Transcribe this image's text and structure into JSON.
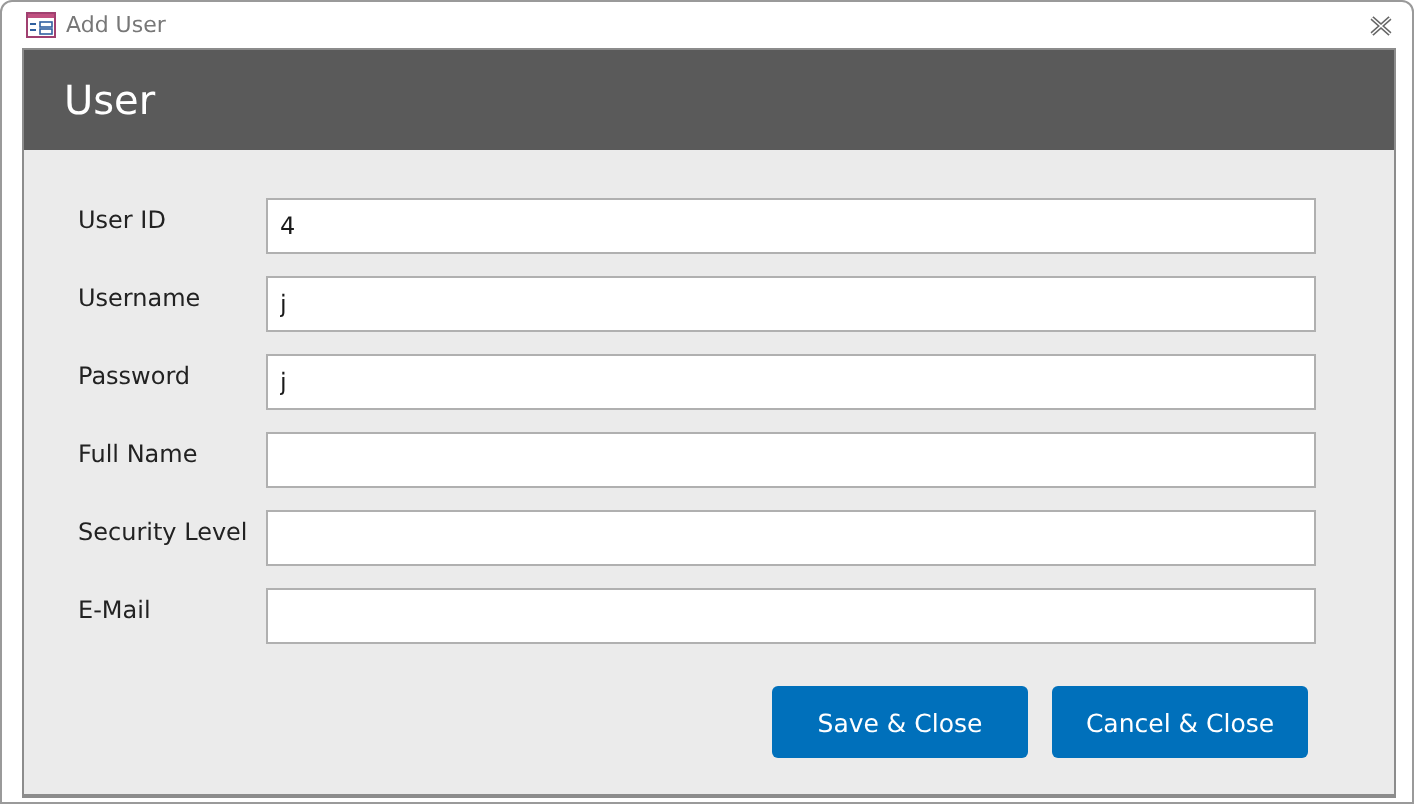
{
  "window": {
    "title": "Add User"
  },
  "header": {
    "title": "User"
  },
  "fields": [
    {
      "label": "User ID",
      "value": "4"
    },
    {
      "label": "Username",
      "value": "j"
    },
    {
      "label": "Password",
      "value": "j"
    },
    {
      "label": "Full Name"
    },
    {
      "label": "Security Level"
    },
    {
      "label": "E-Mail"
    }
  ],
  "buttons": [
    "Save & Close",
    "Cancel & Close"
  ]
}
